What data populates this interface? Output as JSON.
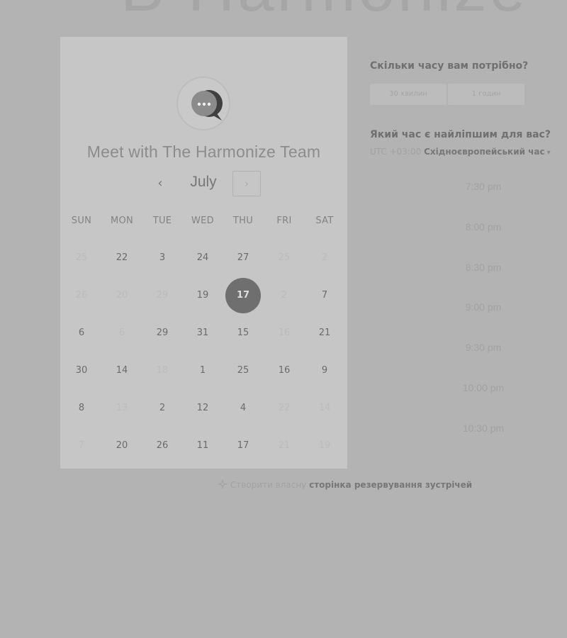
{
  "background_title": "B Harmonize",
  "card": {
    "title": "Meet with The Harmonize Team",
    "logo_icon": "chat-bubble-icon",
    "month": "July",
    "prev_icon": "‹",
    "next_icon": "›",
    "weekdays": [
      "SUN",
      "MON",
      "TUE",
      "WED",
      "THU",
      "FRI",
      "SAT"
    ],
    "selected_day": "17",
    "weeks": [
      [
        {
          "d": "25",
          "a": false
        },
        {
          "d": "22",
          "a": true
        },
        {
          "d": "3",
          "a": true
        },
        {
          "d": "24",
          "a": true
        },
        {
          "d": "27",
          "a": true
        },
        {
          "d": "25",
          "a": false
        },
        {
          "d": "2",
          "a": false
        }
      ],
      [
        {
          "d": "26",
          "a": false
        },
        {
          "d": "20",
          "a": false
        },
        {
          "d": "29",
          "a": false
        },
        {
          "d": "19",
          "a": true
        },
        {
          "d": "17",
          "a": true,
          "s": true
        },
        {
          "d": "2",
          "a": false
        },
        {
          "d": "7",
          "a": true
        }
      ],
      [
        {
          "d": "6",
          "a": true
        },
        {
          "d": "6",
          "a": false
        },
        {
          "d": "29",
          "a": true
        },
        {
          "d": "31",
          "a": true
        },
        {
          "d": "15",
          "a": true
        },
        {
          "d": "16",
          "a": false
        },
        {
          "d": "21",
          "a": true
        }
      ],
      [
        {
          "d": "30",
          "a": true
        },
        {
          "d": "14",
          "a": true
        },
        {
          "d": "18",
          "a": false
        },
        {
          "d": "1",
          "a": true
        },
        {
          "d": "25",
          "a": true
        },
        {
          "d": "16",
          "a": true
        },
        {
          "d": "9",
          "a": true
        }
      ],
      [
        {
          "d": "8",
          "a": true
        },
        {
          "d": "13",
          "a": false
        },
        {
          "d": "2",
          "a": true
        },
        {
          "d": "12",
          "a": true
        },
        {
          "d": "4",
          "a": true
        },
        {
          "d": "22",
          "a": false
        },
        {
          "d": "14",
          "a": false
        }
      ],
      [
        {
          "d": "7",
          "a": false
        },
        {
          "d": "20",
          "a": true
        },
        {
          "d": "26",
          "a": true
        },
        {
          "d": "11",
          "a": true
        },
        {
          "d": "17",
          "a": true
        },
        {
          "d": "21",
          "a": false
        },
        {
          "d": "19",
          "a": false
        }
      ]
    ]
  },
  "duration": {
    "question": "Скільки часу вам потрібно?",
    "options": [
      "30 хвилин",
      "1 годин"
    ]
  },
  "time": {
    "question": "Який час є найліпшим для вас?",
    "tz_offset": "UTC +03:00",
    "tz_name": "Східноєвропейський час",
    "tz_caret": "▾",
    "slots": [
      "7:30 pm",
      "8:00 pm",
      "8:30 pm",
      "9:00 pm",
      "9:30 pm",
      "10:00 pm",
      "10:30 pm"
    ]
  },
  "footer": {
    "icon": "sparkle-icon",
    "light_text": "Створити власну",
    "link_text": "сторінка резервування зустрічей"
  },
  "colors": {
    "background": "#b3b3b3",
    "card": "#c6c6c6",
    "selected_day": "#6f6f6f"
  }
}
